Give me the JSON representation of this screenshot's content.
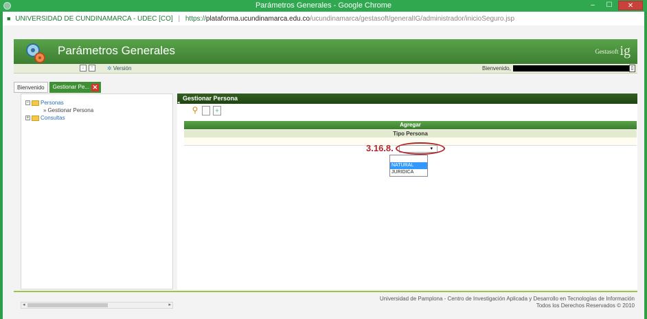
{
  "window": {
    "title": "Parámetros Generales - Google Chrome",
    "controls": {
      "minimize": "–",
      "maximize": "☐",
      "close": "✕"
    }
  },
  "address_bar": {
    "lock_icon": "lock-icon",
    "org": "UNIVERSIDAD DE CUNDINAMARCA - UDEC [CO]",
    "separator": "|",
    "scheme": "https://",
    "host": "plataforma.ucundinamarca.edu.co",
    "path": "/ucundinamarca/gestasoft/generalIG/administrador/inicioSeguro.jsp"
  },
  "app_header": {
    "title": "Parámetros Generales",
    "brand_small": "Gestasoft",
    "brand_big": "ig"
  },
  "subbar": {
    "icon1": "↓",
    "icon2": "↑",
    "version_icon": "✲",
    "version_label": "Versión",
    "welcome_label": "Bienvenido,",
    "mini_btn": "▯"
  },
  "tabs": [
    {
      "label": "Bienvenido"
    },
    {
      "label": "Gestionar Pe...",
      "close": "✕"
    }
  ],
  "tree": {
    "node1": {
      "toggle": "−",
      "label": "Personas"
    },
    "child1": {
      "bullet": "»",
      "label": "Gestionar Persona"
    },
    "node2": {
      "toggle": "+",
      "label": "Consultas"
    }
  },
  "scroll": {
    "left": "◂",
    "right": "▸"
  },
  "panel": {
    "collapse": "◂",
    "header": "Gestionar Persona",
    "tools": {
      "search": "⚲",
      "new_doc": "",
      "add_doc": "+"
    },
    "agregar": "Agregar",
    "tipo_label": "Tipo Persona",
    "annotation": "3.16.8.",
    "select_arrow": "▾",
    "options": [
      "",
      "NATURAL",
      "JURIDICA"
    ],
    "selected_option": "NATURAL"
  },
  "footer": {
    "line1": "Universidad de Pamplona - Centro de Investigación Aplicada y Desarrollo en Tecnologías de Información",
    "line2": "Todos los Derechos Reservados © 2010"
  },
  "colors": {
    "titlebar": "#2fa84f",
    "header_green": "#4a9140",
    "panel_head": "#2a5319",
    "annotation_red": "#b0262b",
    "selection_blue": "#3399ff"
  }
}
